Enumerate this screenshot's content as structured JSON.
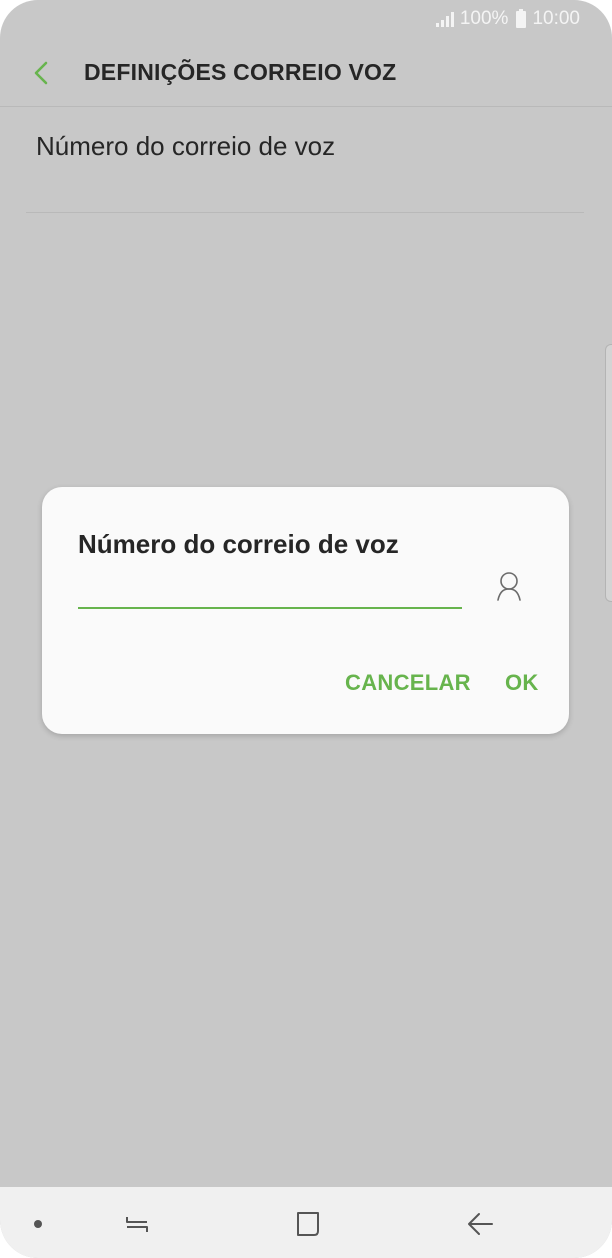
{
  "status_bar": {
    "battery": "100%",
    "time": "10:00"
  },
  "header": {
    "title": "DEFINIÇÕES CORREIO VOZ",
    "back_icon": "chevron-left-icon"
  },
  "list": {
    "item_label": "Número do correio de voz"
  },
  "dialog": {
    "title": "Número do correio de voz",
    "input_value": "",
    "contact_icon": "contact-person-icon",
    "cancel_label": "CANCELAR",
    "ok_label": "OK"
  },
  "nav_bar": {
    "icons": [
      "dot-icon",
      "recents-icon",
      "home-icon",
      "back-icon"
    ]
  },
  "colors": {
    "accent": "#67b44d",
    "overlay_background": "#c8c8c8",
    "dialog_background": "#fafafa",
    "nav_background": "#f0f0f0"
  }
}
